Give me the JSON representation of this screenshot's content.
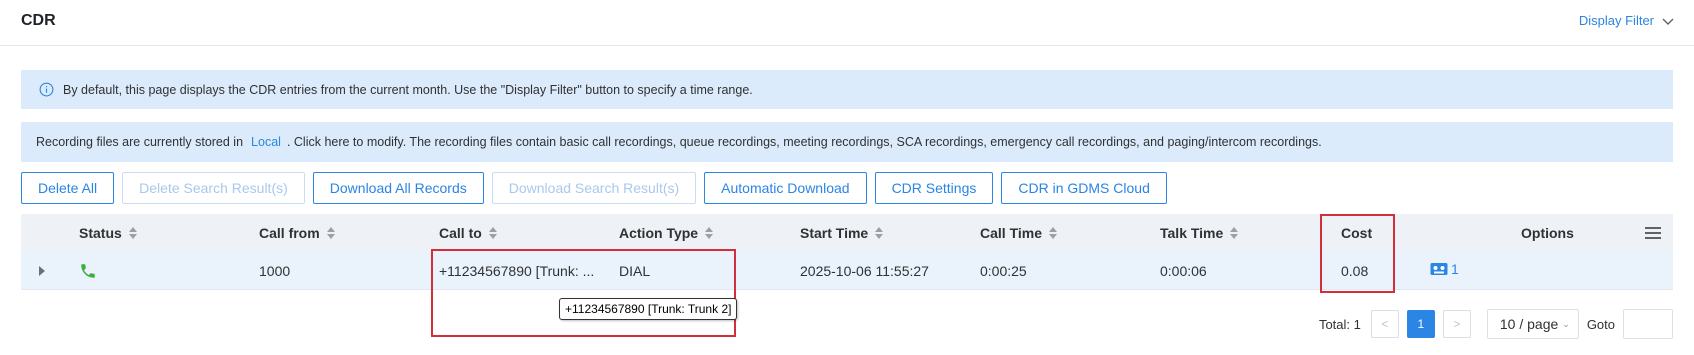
{
  "header": {
    "title": "CDR",
    "display_filter": "Display Filter"
  },
  "info_banner": {
    "text": "By default, this page displays the CDR entries from the current month. Use the \"Display Filter\" button to specify a time range."
  },
  "recording_banner": {
    "prefix": "Recording files are currently stored in",
    "link": "Local",
    "suffix": ". Click here to modify. The recording files contain basic call recordings, queue recordings, meeting recordings, SCA recordings, emergency call recordings, and paging/intercom recordings."
  },
  "toolbar": {
    "delete_all": "Delete All",
    "delete_search": "Delete Search Result(s)",
    "download_all": "Download All Records",
    "download_search": "Download Search Result(s)",
    "automatic_download": "Automatic Download",
    "cdr_settings": "CDR Settings",
    "cdr_gdms": "CDR in GDMS Cloud"
  },
  "table": {
    "columns": {
      "status": "Status",
      "call_from": "Call from",
      "call_to": "Call to",
      "action_type": "Action Type",
      "start_time": "Start Time",
      "call_time": "Call Time",
      "talk_time": "Talk Time",
      "cost": "Cost",
      "options": "Options"
    },
    "rows": [
      {
        "status_icon": "phone-answered-icon",
        "call_from": "1000",
        "call_to": "+11234567890 [Trunk: ...",
        "action_type": "DIAL",
        "start_time": "2025-10-06 11:55:27",
        "call_time": "0:00:25",
        "talk_time": "0:00:06",
        "cost": "0.08",
        "recordings_count": "1"
      }
    ]
  },
  "tooltip": {
    "text": "+11234567890 [Trunk: Trunk 2]"
  },
  "pagination": {
    "total": "Total: 1",
    "prev": "<",
    "current_page": "1",
    "next": ">",
    "page_size": "10 / page",
    "goto": "Goto"
  },
  "colors": {
    "accent": "#2b85e4",
    "banner": "#dcebfb",
    "highlight": "#d32f3a",
    "status_green": "#3cae3c"
  }
}
